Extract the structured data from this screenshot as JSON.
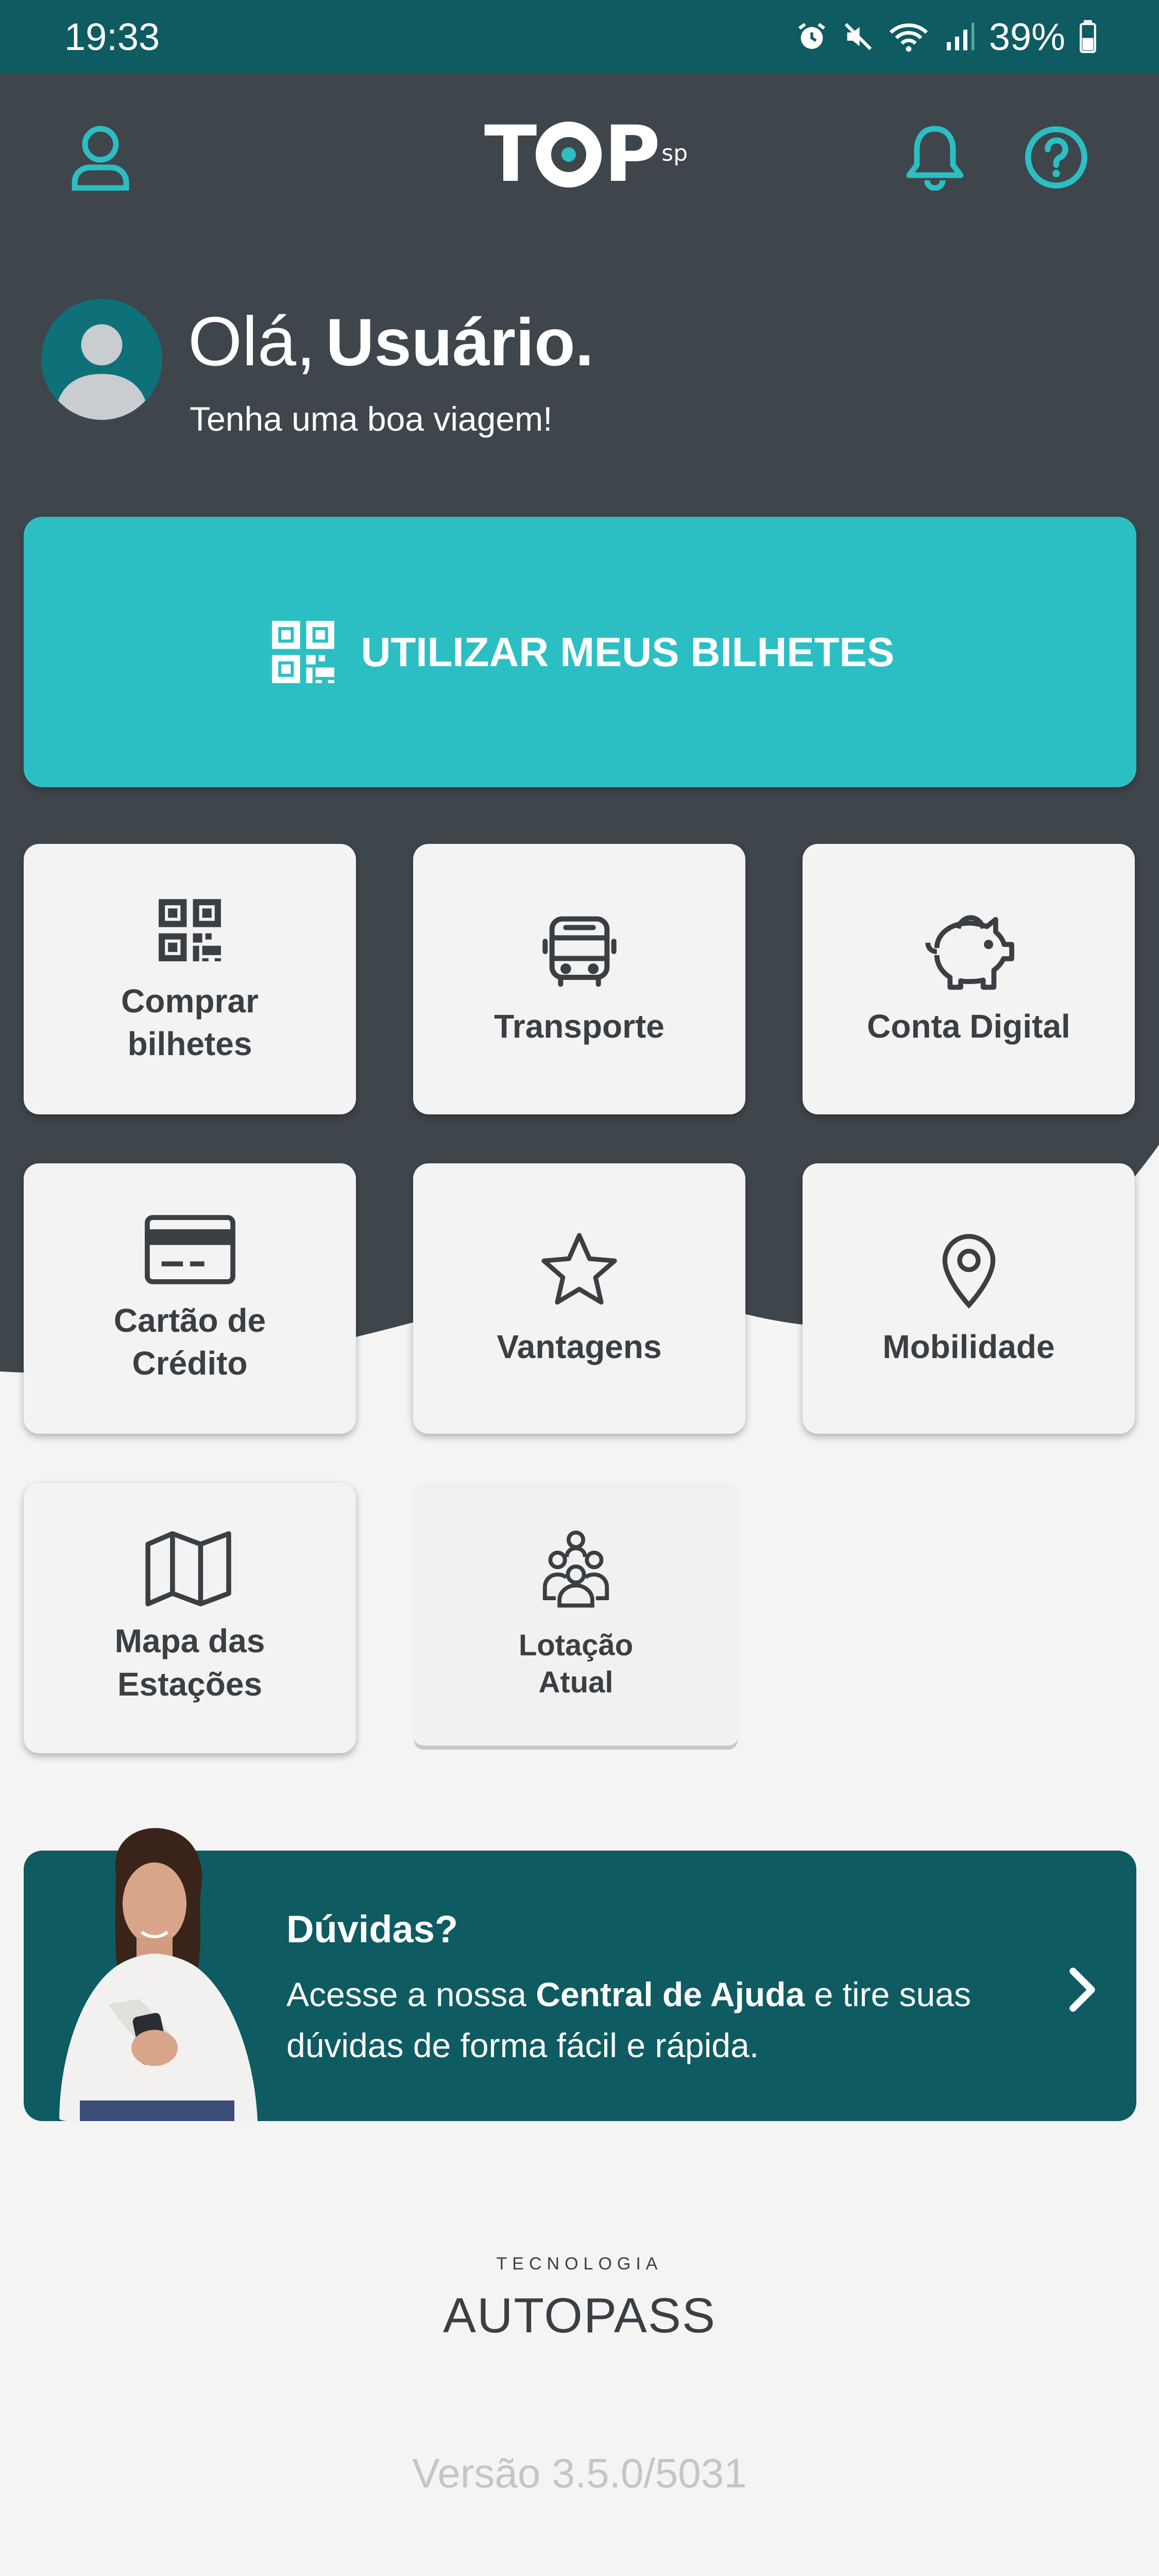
{
  "status_bar": {
    "time": "19:33",
    "battery": "39%",
    "icons": [
      "alarm-icon",
      "mute-icon",
      "wifi-icon",
      "signal-icon",
      "battery-icon"
    ]
  },
  "header": {
    "logo_text_t": "T",
    "logo_text_p": "P",
    "logo_sub": "sp",
    "icons": [
      "profile-icon",
      "bell-icon",
      "help-icon"
    ]
  },
  "greeting": {
    "hello": "Olá,",
    "name": "Usuário.",
    "subtitle": "Tenha uma boa viagem!"
  },
  "cta": {
    "label": "UTILIZAR MEUS BILHETES",
    "icon": "qr-code-icon"
  },
  "tiles": [
    {
      "label": "Comprar\nbilhetes",
      "icon": "qr-code-icon"
    },
    {
      "label": "Transporte",
      "icon": "bus-icon"
    },
    {
      "label": "Conta Digital",
      "icon": "piggy-bank-icon"
    },
    {
      "label": "Cartão de\nCrédito",
      "icon": "credit-card-icon"
    },
    {
      "label": "Vantagens",
      "icon": "star-icon"
    },
    {
      "label": "Mobilidade",
      "icon": "map-pin-icon"
    },
    {
      "label": "Mapa das\nEstações",
      "icon": "map-icon"
    },
    {
      "label": "Lotação\nAtual",
      "icon": "crowd-icon"
    }
  ],
  "help_banner": {
    "title": "Dúvidas?",
    "text_before": "Acesse a nossa ",
    "text_bold": "Central de Ajuda",
    "text_after": " e tire suas dúvidas de forma fácil e rápida."
  },
  "footer": {
    "tech_label": "TECNOLOGIA",
    "brand": "AUTOPASS",
    "version": "Versão 3.5.0/5031"
  },
  "colors": {
    "status_bar": "#0E5B62",
    "header_dark": "#3F464B",
    "accent": "#2BBFC4",
    "banner": "#0E5B62",
    "background": "#F4F4F4"
  }
}
